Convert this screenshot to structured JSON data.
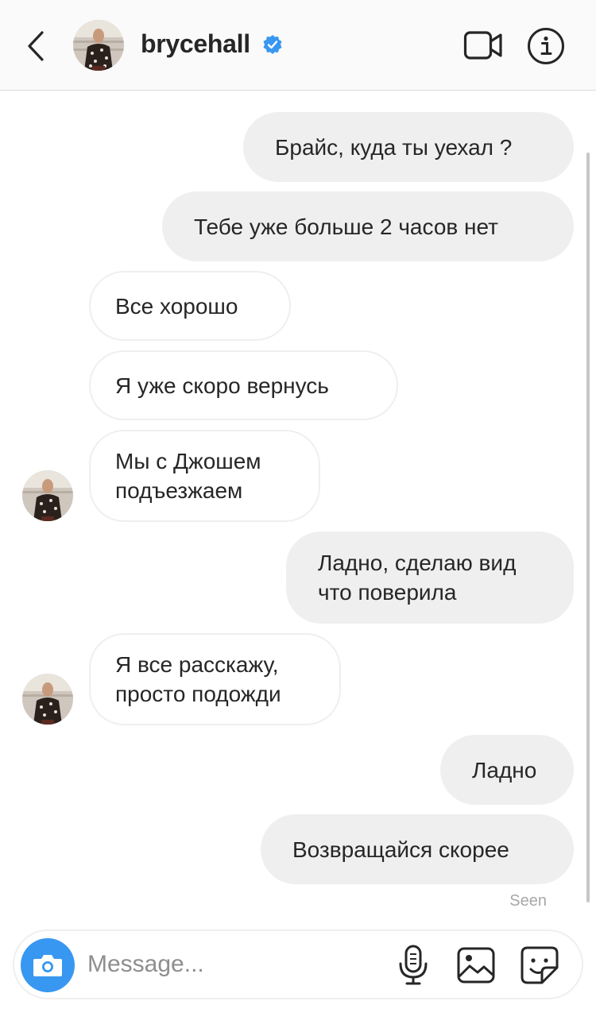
{
  "header": {
    "username": "brycehall",
    "verified": true,
    "icons": {
      "back": "chevron-left-icon",
      "verified": "verified-badge-icon",
      "video": "video-call-icon",
      "info": "info-icon"
    }
  },
  "messages": [
    {
      "from": "me",
      "text": "Брайс, куда ты уехал ?"
    },
    {
      "from": "me",
      "text": "Тебе уже больше 2 часов нет"
    },
    {
      "from": "them",
      "text": "Все хорошо"
    },
    {
      "from": "them",
      "text": "Я уже скоро вернусь"
    },
    {
      "from": "them",
      "text": "Мы с Джошем\nподъезжаем"
    },
    {
      "from": "me",
      "text": "Ладно, сделаю вид\nчто поверила"
    },
    {
      "from": "them",
      "text": "Я все расскажу,\nпросто подожди"
    },
    {
      "from": "me",
      "text": "Ладно"
    },
    {
      "from": "me",
      "text": "Возвращайся скорее"
    }
  ],
  "seen_label": "Seen",
  "composer": {
    "placeholder": "Message...",
    "icons": {
      "camera": "camera-icon",
      "mic": "microphone-icon",
      "gallery": "gallery-icon",
      "sticker": "sticker-icon"
    }
  },
  "colors": {
    "accent": "#3897f0",
    "verified_blue": "#3897f0",
    "sent_bubble": "#efefef",
    "received_border": "#efefef",
    "text": "#262626",
    "muted": "#a8a8a8"
  }
}
